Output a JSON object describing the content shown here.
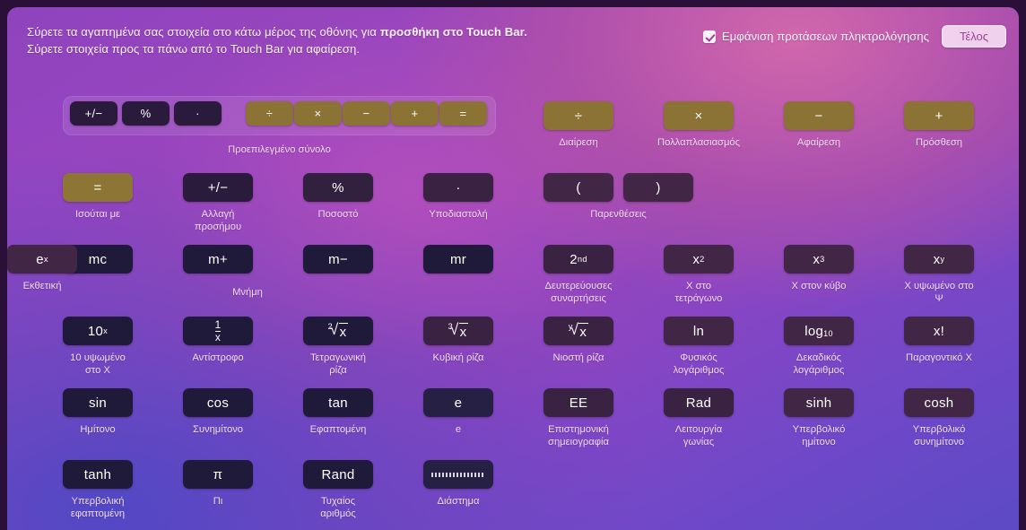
{
  "header": {
    "hint_line1_pre": "Σύρετε τα αγαπημένα σας στοιχεία στο κάτω μέρος της οθόνης για ",
    "hint_line1_strong": "προσθήκη στο Touch Bar.",
    "hint_line2": "Σύρετε στοιχεία προς τα πάνω από το Touch Bar για αφαίρεση.",
    "checkbox_label": "Εμφάνιση προτάσεων πληκτρολόγησης",
    "checkbox_checked": true,
    "done_label": "Τέλος"
  },
  "colors": {
    "accent_gold": "#8a7334",
    "key_dark": "#2a1b3d",
    "caption": "#f0dcf2",
    "done_text": "#a14093"
  },
  "preset_group": {
    "caption": "Προεπιλεγμένο σύνολο",
    "keys": [
      {
        "glyph": "+/−",
        "name": "sign-change-key",
        "tone": "dark"
      },
      {
        "glyph": "%",
        "name": "percent-key",
        "tone": "dark"
      },
      {
        "glyph": "·",
        "name": "decimal-key",
        "tone": "dark"
      },
      {
        "glyph": "÷",
        "name": "divide-key",
        "tone": "gold"
      },
      {
        "glyph": "×",
        "name": "multiply-key",
        "tone": "gold"
      },
      {
        "glyph": "−",
        "name": "subtract-key",
        "tone": "gold"
      },
      {
        "glyph": "+",
        "name": "add-key",
        "tone": "gold"
      },
      {
        "glyph": "=",
        "name": "equals-key",
        "tone": "gold"
      }
    ]
  },
  "rows": [
    {
      "id": "row-1",
      "cells": [
        {
          "name": "divide-button",
          "glyph": "÷",
          "caption": "Διαίρεση",
          "tone": "gold",
          "width": 78
        },
        {
          "name": "multiply-button",
          "glyph": "×",
          "caption": "Πολλαπλασιασμός",
          "tone": "gold",
          "width": 78
        },
        {
          "name": "subtract-button",
          "glyph": "−",
          "caption": "Αφαίρεση",
          "tone": "gold",
          "width": 78
        },
        {
          "name": "add-button",
          "glyph": "+",
          "caption": "Πρόσθεση",
          "tone": "gold",
          "width": 78
        }
      ]
    },
    {
      "id": "row-2",
      "cells": [
        {
          "name": "equals-button",
          "glyph": "=",
          "caption": "Ισούται με",
          "tone": "gold2",
          "width": 78
        },
        {
          "name": "sign-change-button",
          "glyph": "+/−",
          "caption": "Αλλαγή προσήμου",
          "tone": "dark",
          "width": 78
        },
        {
          "name": "percent-button",
          "glyph": "%",
          "caption": "Ποσοστό",
          "tone": "dark2",
          "width": 78
        },
        {
          "name": "decimal-button",
          "glyph": "·",
          "caption": "Υποδιαστολή",
          "tone": "dark3",
          "width": 78
        }
      ]
    },
    {
      "id": "row-3",
      "cells": [
        {
          "name": "memory-clear-button",
          "glyph": "mc",
          "caption": "",
          "tone": "dark5",
          "width": 78
        },
        {
          "name": "memory-add-button",
          "glyph": "m+",
          "caption": "",
          "tone": "dark5",
          "width": 78
        },
        {
          "name": "memory-sub-button",
          "glyph": "m−",
          "caption": "",
          "tone": "dark5",
          "width": 78
        },
        {
          "name": "memory-recall-button",
          "glyph": "mr",
          "caption": "",
          "tone": "dark5",
          "width": 78
        },
        {
          "name": "second-functions-button",
          "glyph": "2nd",
          "caption": "Δευτερεύουσες\nσυναρτήσεις",
          "tone": "dark3",
          "width": 78
        },
        {
          "name": "x-squared-button",
          "glyph": "x2",
          "caption": "Χ στο τετράγωνο",
          "tone": "dark4",
          "width": 78
        },
        {
          "name": "x-cubed-button",
          "glyph": "x3",
          "caption": "Χ στον κύβο",
          "tone": "dark4",
          "width": 78
        },
        {
          "name": "x-to-y-button",
          "glyph": "xy",
          "caption": "Χ υψωμένο στο Ψ",
          "tone": "dark4",
          "width": 78
        },
        {
          "name": "exponential-button",
          "glyph": "ex",
          "caption": "Εκθετική",
          "tone": "dark4",
          "width": 78
        }
      ],
      "memory_caption": "Μνήμη"
    },
    {
      "id": "row-4",
      "cells": [
        {
          "name": "ten-to-x-button",
          "glyph": "10x",
          "caption": "10 υψωμένο στο Χ",
          "tone": "dark5",
          "width": 78
        },
        {
          "name": "reciprocal-button",
          "glyph": "1/x",
          "caption": "Αντίστροφο",
          "tone": "dark5",
          "width": 78
        },
        {
          "name": "square-root-button",
          "glyph": "root2",
          "caption": "Τετραγωνική ρίζα",
          "tone": "dark5",
          "width": 78
        },
        {
          "name": "cube-root-button",
          "glyph": "root3",
          "caption": "Κυβική ρίζα",
          "tone": "dark3",
          "width": 78
        },
        {
          "name": "nth-root-button",
          "glyph": "rooty",
          "caption": "Νιοστή ρίζα",
          "tone": "dark3",
          "width": 78
        },
        {
          "name": "natural-log-button",
          "glyph": "ln",
          "caption": "Φυσικός λογάριθμος",
          "tone": "dark4",
          "width": 78
        },
        {
          "name": "log10-button",
          "glyph": "log10",
          "caption": "Δεκαδικός\nλογάριθμος",
          "tone": "dark4",
          "width": 78
        },
        {
          "name": "factorial-button",
          "glyph": "x!",
          "caption": "Παραγοντικό Χ",
          "tone": "dark4",
          "width": 78
        }
      ]
    },
    {
      "id": "row-5",
      "cells": [
        {
          "name": "sine-button",
          "glyph": "sin",
          "caption": "Ημίτονο",
          "tone": "dark5",
          "width": 78
        },
        {
          "name": "cosine-button",
          "glyph": "cos",
          "caption": "Συνημίτονο",
          "tone": "dark5",
          "width": 78
        },
        {
          "name": "tangent-button",
          "glyph": "tan",
          "caption": "Εφαπτομένη",
          "tone": "dark5",
          "width": 78
        },
        {
          "name": "e-button",
          "glyph": "e",
          "caption": "e",
          "tone": "dark6",
          "width": 78
        },
        {
          "name": "scientific-notation-button",
          "glyph": "EE",
          "caption": "Επιστημονική\nσημειογραφία",
          "tone": "dark3",
          "width": 78
        },
        {
          "name": "radians-button",
          "glyph": "Rad",
          "caption": "Λειτουργία γωνίας",
          "tone": "dark3",
          "width": 78
        },
        {
          "name": "sinh-button",
          "glyph": "sinh",
          "caption": "Υπερβολικό ημίτονο",
          "tone": "dark4",
          "width": 78
        },
        {
          "name": "cosh-button",
          "glyph": "cosh",
          "caption": "Υπερβολικό\nσυνημίτονο",
          "tone": "dark4",
          "width": 78
        }
      ]
    },
    {
      "id": "row-6",
      "cells": [
        {
          "name": "tanh-button",
          "glyph": "tanh",
          "caption": "Υπερβολική\nεφαπτομένη",
          "tone": "dark5",
          "width": 78
        },
        {
          "name": "pi-button",
          "glyph": "π",
          "caption": "Πι",
          "tone": "dark5",
          "width": 78
        },
        {
          "name": "random-button",
          "glyph": "Rand",
          "caption": "Τυχαίος αριθμός",
          "tone": "dark5",
          "width": 78
        },
        {
          "name": "space-button",
          "glyph": "space",
          "caption": "Διάστημα",
          "tone": "dark6",
          "width": 78
        }
      ]
    }
  ],
  "parens": {
    "caption": "Παρενθέσεις",
    "open_glyph": "(",
    "close_glyph": ")",
    "open_name": "open-paren-button",
    "close_name": "close-paren-button"
  }
}
